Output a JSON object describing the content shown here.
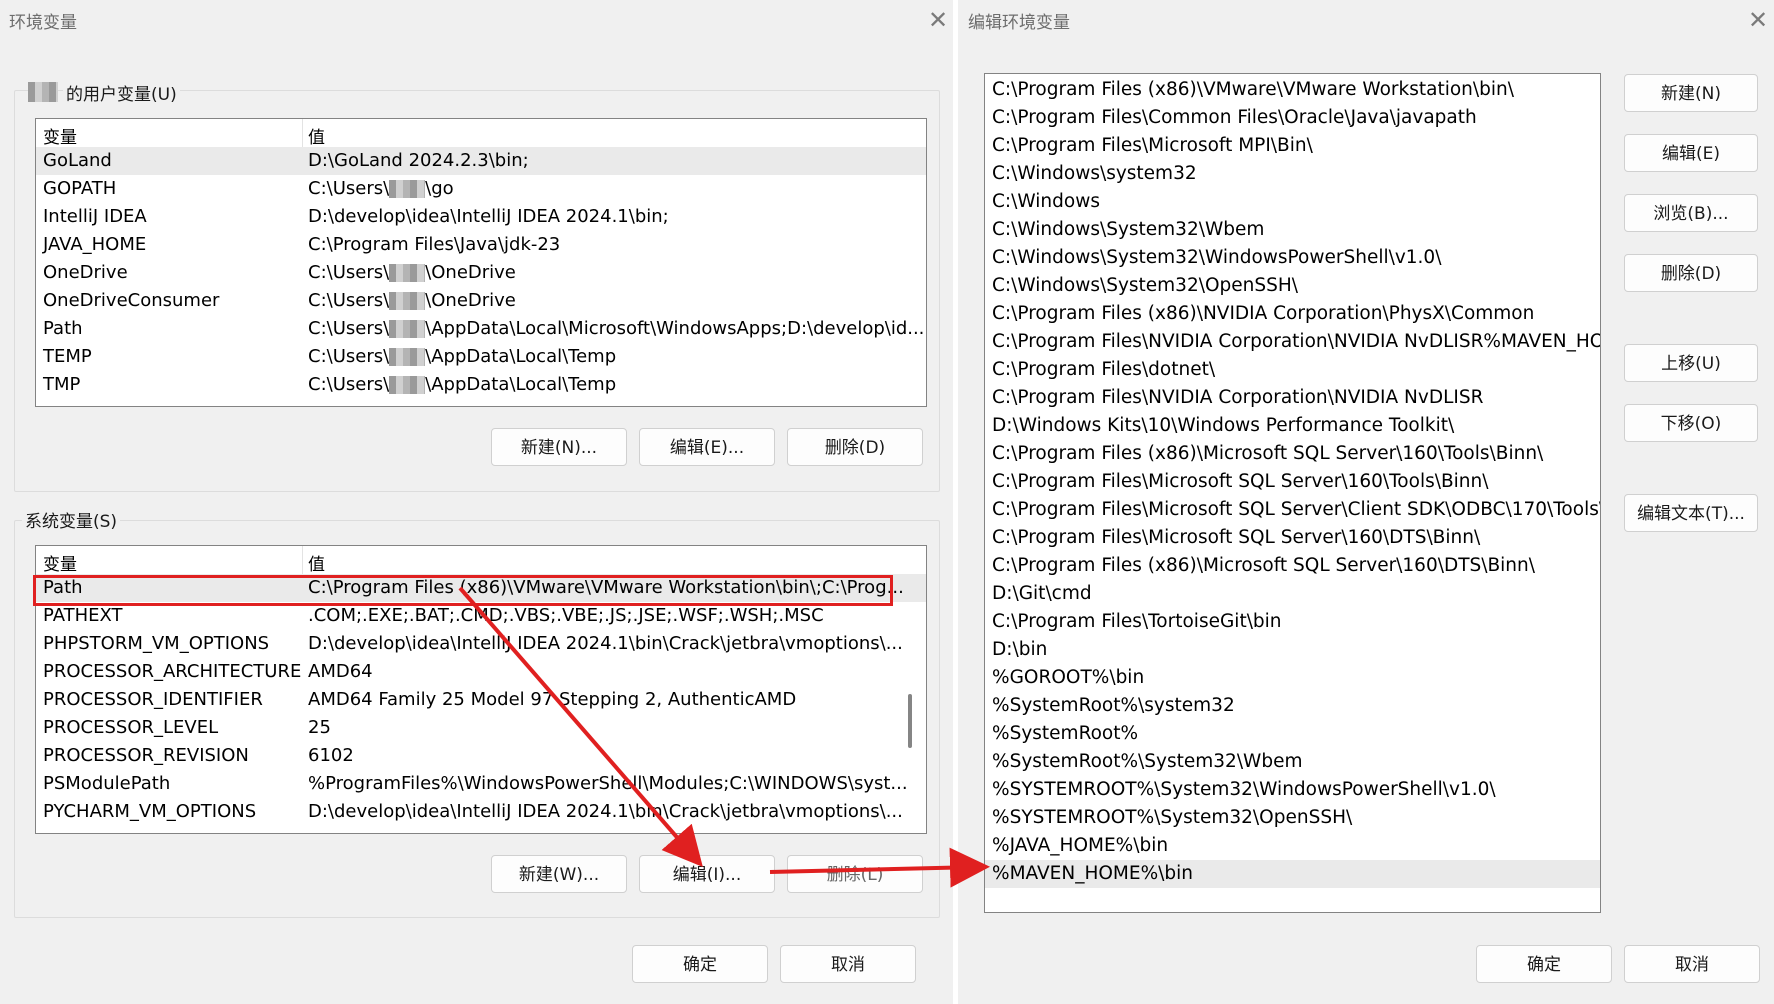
{
  "env_dialog": {
    "title": "环境变量",
    "user_group_label": "的用户变量(U)",
    "system_group_label": "系统变量(S)",
    "col_var": "变量",
    "col_val": "值",
    "user_vars": [
      {
        "k": "GoLand",
        "v": "D:\\GoLand 2024.2.3\\bin;"
      },
      {
        "k": "GOPATH",
        "v": "C:\\Users\\",
        "v2": "\\go"
      },
      {
        "k": "IntelliJ IDEA",
        "v": "D:\\develop\\idea\\IntelliJ IDEA 2024.1\\bin;"
      },
      {
        "k": "JAVA_HOME",
        "v": "C:\\Program Files\\Java\\jdk-23"
      },
      {
        "k": "OneDrive",
        "v": "C:\\Users\\",
        "v2": "\\OneDrive"
      },
      {
        "k": "OneDriveConsumer",
        "v": "C:\\Users\\",
        "v2": "\\OneDrive"
      },
      {
        "k": "Path",
        "v": "C:\\Users\\",
        "v2": "\\AppData\\Local\\Microsoft\\WindowsApps;D:\\develop\\id..."
      },
      {
        "k": "TEMP",
        "v": "C:\\Users\\",
        "v2": "\\AppData\\Local\\Temp"
      },
      {
        "k": "TMP",
        "v": "C:\\Users\\",
        "v2": "\\AppData\\Local\\Temp"
      }
    ],
    "user_buttons": {
      "new": "新建(N)...",
      "edit": "编辑(E)...",
      "delete": "删除(D)"
    },
    "system_vars": [
      {
        "k": "Path",
        "v": "C:\\Program Files (x86)\\VMware\\VMware Workstation\\bin\\;C:\\Prog..."
      },
      {
        "k": "PATHEXT",
        "v": ".COM;.EXE;.BAT;.CMD;.VBS;.VBE;.JS;.JSE;.WSF;.WSH;.MSC"
      },
      {
        "k": "PHPSTORM_VM_OPTIONS",
        "v": "D:\\develop\\idea\\IntelliJ IDEA 2024.1\\bin\\Crack\\jetbra\\vmoptions\\..."
      },
      {
        "k": "PROCESSOR_ARCHITECTURE",
        "v": "AMD64"
      },
      {
        "k": "PROCESSOR_IDENTIFIER",
        "v": "AMD64 Family 25 Model 97 Stepping 2, AuthenticAMD"
      },
      {
        "k": "PROCESSOR_LEVEL",
        "v": "25"
      },
      {
        "k": "PROCESSOR_REVISION",
        "v": "6102"
      },
      {
        "k": "PSModulePath",
        "v": "%ProgramFiles%\\WindowsPowerShell\\Modules;C:\\WINDOWS\\syst..."
      },
      {
        "k": "PYCHARM_VM_OPTIONS",
        "v": "D:\\develop\\idea\\IntelliJ IDEA 2024.1\\bin\\Crack\\jetbra\\vmoptions\\..."
      }
    ],
    "system_buttons": {
      "new": "新建(W)...",
      "edit": "编辑(I)...",
      "delete": "删除(L)"
    },
    "ok": "确定",
    "cancel": "取消"
  },
  "edit_dialog": {
    "title": "编辑环境变量",
    "paths": [
      "C:\\Program Files (x86)\\VMware\\VMware Workstation\\bin\\",
      "C:\\Program Files\\Common Files\\Oracle\\Java\\javapath",
      "C:\\Program Files\\Microsoft MPI\\Bin\\",
      "C:\\Windows\\system32",
      "C:\\Windows",
      "C:\\Windows\\System32\\Wbem",
      "C:\\Windows\\System32\\WindowsPowerShell\\v1.0\\",
      "C:\\Windows\\System32\\OpenSSH\\",
      "C:\\Program Files (x86)\\NVIDIA Corporation\\PhysX\\Common",
      "C:\\Program Files\\NVIDIA Corporation\\NVIDIA NvDLISR%MAVEN_HO...",
      "C:\\Program Files\\dotnet\\",
      "C:\\Program Files\\NVIDIA Corporation\\NVIDIA NvDLISR",
      "D:\\Windows Kits\\10\\Windows Performance Toolkit\\",
      "C:\\Program Files (x86)\\Microsoft SQL Server\\160\\Tools\\Binn\\",
      "C:\\Program Files\\Microsoft SQL Server\\160\\Tools\\Binn\\",
      "C:\\Program Files\\Microsoft SQL Server\\Client SDK\\ODBC\\170\\Tools\\...",
      "C:\\Program Files\\Microsoft SQL Server\\160\\DTS\\Binn\\",
      "C:\\Program Files (x86)\\Microsoft SQL Server\\160\\DTS\\Binn\\",
      "D:\\Git\\cmd",
      "C:\\Program Files\\TortoiseGit\\bin",
      "D:\\bin",
      "%GOROOT%\\bin",
      "%SystemRoot%\\system32",
      "%SystemRoot%",
      "%SystemRoot%\\System32\\Wbem",
      "%SYSTEMROOT%\\System32\\WindowsPowerShell\\v1.0\\",
      "%SYSTEMROOT%\\System32\\OpenSSH\\",
      "%JAVA_HOME%\\bin",
      "%MAVEN_HOME%\\bin"
    ],
    "buttons": {
      "new": "新建(N)",
      "edit": "编辑(E)",
      "browse": "浏览(B)...",
      "delete": "删除(D)",
      "up": "上移(U)",
      "down": "下移(O)",
      "edit_text": "编辑文本(T)..."
    },
    "ok": "确定",
    "cancel": "取消"
  },
  "colors": {
    "highlight": "#e02020",
    "arrow": "#e02020"
  }
}
